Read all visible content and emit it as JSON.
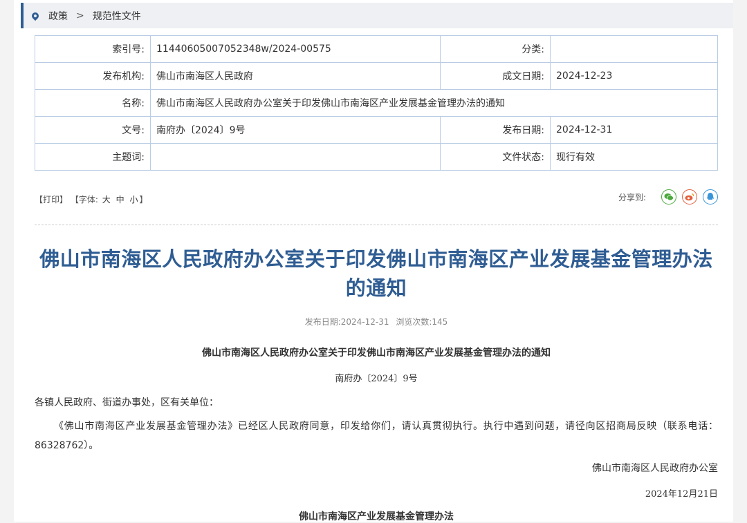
{
  "breadcrumb": {
    "items": [
      "政策",
      "规范性文件"
    ],
    "separator": ">"
  },
  "info": {
    "index_label": "索引号:",
    "index_value": "11440605007052348w/2024-00575",
    "category_label": "分类:",
    "category_value": "",
    "publisher_label": "发布机构:",
    "publisher_value": "佛山市南海区人民政府",
    "created_label": "成文日期:",
    "created_value": "2024-12-23",
    "name_label": "名称:",
    "name_value": "佛山市南海区人民政府办公室关于印发佛山市南海区产业发展基金管理办法的通知",
    "docno_label": "文号:",
    "docno_value": "南府办〔2024〕9号",
    "pubdate_label": "发布日期:",
    "pubdate_value": "2024-12-31",
    "keywords_label": "主题词:",
    "keywords_value": "",
    "status_label": "文件状态:",
    "status_value": "现行有效"
  },
  "tools": {
    "print": "打印",
    "font_label": "字体:",
    "large": "大",
    "medium": "中",
    "small": "小"
  },
  "share": {
    "label": "分享到:",
    "icons": [
      "wechat-icon",
      "weibo-icon",
      "qq-icon"
    ]
  },
  "article": {
    "title_line1": "佛山市南海区人民政府办公室关于印发佛山市南海区产业发展基金管理办法",
    "title_line2": "的通知",
    "meta_date_label": "发布日期:",
    "meta_date": "2024-12-31",
    "meta_views_label": "浏览次数:",
    "meta_views": "145",
    "doc_head": "佛山市南海区人民政府办公室关于印发佛山市南海区产业发展基金管理办法的通知",
    "doc_num": "南府办〔2024〕9号",
    "addressee": "各镇人民政府、街道办事处，区有关单位：",
    "body": "《佛山市南海区产业发展基金管理办法》已经区人民政府同意，印发给你们，请认真贯彻执行。执行中遇到问题，请径向区招商局反映（联系电话：86328762）。",
    "signer": "佛山市南海区人民政府办公室",
    "sign_date": "2024年12月21日",
    "sub_title": "佛山市南海区产业发展基金管理办法"
  },
  "colors": {
    "accent": "#2f5d93",
    "border": "#b9cce4"
  }
}
